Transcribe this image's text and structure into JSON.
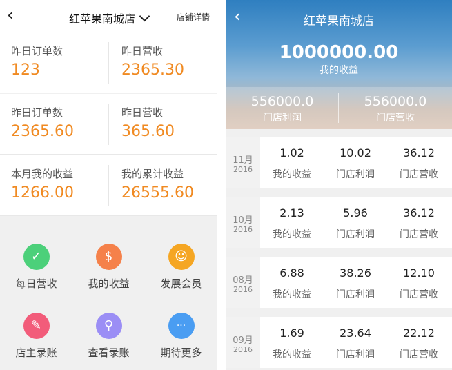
{
  "left": {
    "header": {
      "back_icon": "chevron-left-icon",
      "back_glyph": "‹",
      "title": "红苹果南城店",
      "detail": "店铺详情"
    },
    "stats": [
      [
        {
          "label": "昨日订单数",
          "value": "123"
        },
        {
          "label": "昨日营收",
          "value": "2365.30"
        }
      ],
      [
        {
          "label": "昨日订单数",
          "value": "2365.60"
        },
        {
          "label": "昨日营收",
          "value": "365.60"
        }
      ],
      [
        {
          "label": "本月我的收益",
          "value": "1266.00"
        },
        {
          "label": "我的累计收益",
          "value": "26555.60"
        }
      ]
    ],
    "accent_color": "#f08a22",
    "menu": [
      {
        "label": "每日营收",
        "icon": "clipboard-check-icon",
        "glyph": "✓",
        "color": "#4cd07a"
      },
      {
        "label": "我的收益",
        "icon": "money-stack-icon",
        "glyph": "$",
        "color": "#f5814a"
      },
      {
        "label": "发展会员",
        "icon": "members-icon",
        "glyph": "☺",
        "color": "#f5a623"
      },
      {
        "label": "店主录账",
        "icon": "edit-record-icon",
        "glyph": "✎",
        "color": "#f25c7a"
      },
      {
        "label": "查看录账",
        "icon": "view-record-icon",
        "glyph": "⚲",
        "color": "#9b8ef5"
      },
      {
        "label": "期待更多",
        "icon": "more-icon",
        "glyph": "···",
        "color": "#4a9df2"
      }
    ]
  },
  "right": {
    "header": {
      "back_icon": "chevron-left-icon",
      "back_glyph": "‹",
      "title": "红苹果南城店"
    },
    "total": {
      "value": "1000000.00",
      "label": "我的收益"
    },
    "subtotals": [
      {
        "value": "556000.0",
        "label": "门店利润"
      },
      {
        "value": "556000.0",
        "label": "门店营收"
      }
    ],
    "months": [
      {
        "month": "11月",
        "year": "2016",
        "cells": [
          {
            "value": "1.02",
            "label": "我的收益"
          },
          {
            "value": "10.02",
            "label": "门店利润"
          },
          {
            "value": "36.12",
            "label": "门店营收"
          }
        ]
      },
      {
        "month": "10月",
        "year": "2016",
        "cells": [
          {
            "value": "2.13",
            "label": "我的收益"
          },
          {
            "value": "5.96",
            "label": "门店利润"
          },
          {
            "value": "36.12",
            "label": "门店营收"
          }
        ]
      },
      {
        "month": "08月",
        "year": "2016",
        "cells": [
          {
            "value": "6.88",
            "label": "我的收益"
          },
          {
            "value": "38.26",
            "label": "门店利润"
          },
          {
            "value": "12.10",
            "label": "门店营收"
          }
        ]
      },
      {
        "month": "09月",
        "year": "2016",
        "cells": [
          {
            "value": "1.69",
            "label": "我的收益"
          },
          {
            "value": "23.64",
            "label": "门店利润"
          },
          {
            "value": "22.12",
            "label": "门店营收"
          }
        ]
      }
    ]
  }
}
